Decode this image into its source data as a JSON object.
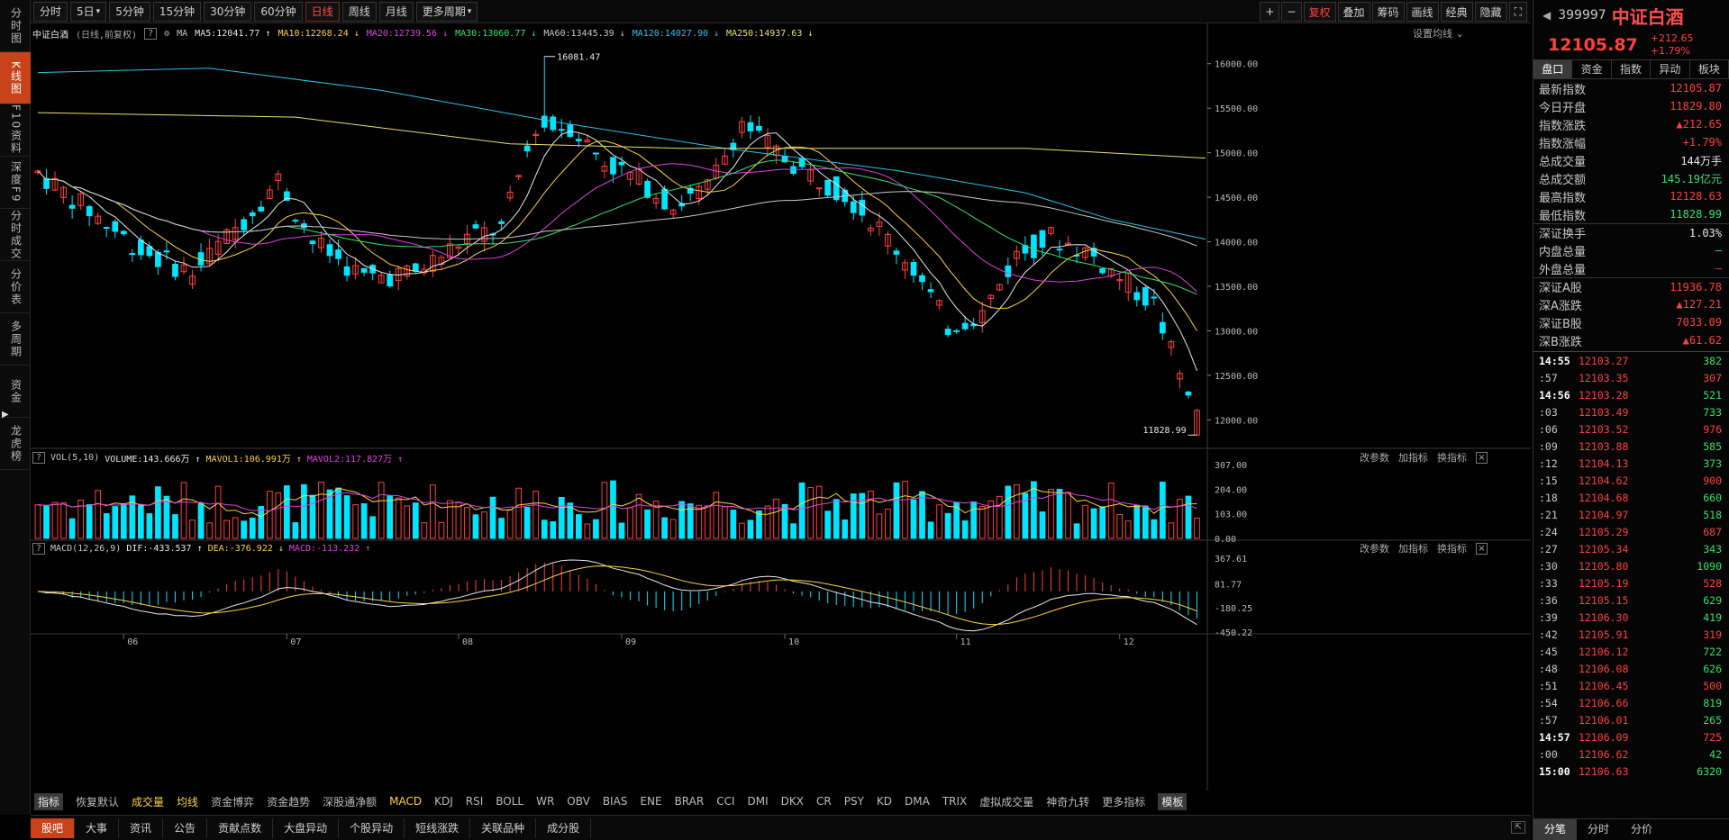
{
  "left_sidebar": {
    "items": [
      "分时图",
      "K线图",
      "F10资料",
      "深度F9",
      "分时成交",
      "分价表",
      "多周期",
      "资金",
      "龙虎榜"
    ],
    "active_index": 1
  },
  "toolbar": {
    "periods": [
      "分时",
      "5日",
      "5分钟",
      "15分钟",
      "30分钟",
      "60分钟",
      "日线",
      "周线",
      "月线",
      "更多周期"
    ],
    "active_period": "日线",
    "right_buttons": [
      "+",
      "−",
      "复权",
      "叠加",
      "筹码",
      "画线",
      "经典",
      "隐藏",
      "⛶"
    ]
  },
  "ma_line": {
    "title": "中证白酒",
    "subtitle": "(日线,前复权)",
    "ma_label": "MA",
    "items": [
      {
        "label": "MA5:12041.77",
        "arrow": "↑",
        "color": "#e8e8e8"
      },
      {
        "label": "MA10:12268.24",
        "arrow": "↓",
        "color": "#ffd23f"
      },
      {
        "label": "MA20:12739.56",
        "arrow": "↓",
        "color": "#e040e0"
      },
      {
        "label": "MA30:13060.77",
        "arrow": "↓",
        "color": "#33e36a"
      },
      {
        "label": "MA60:13445.39",
        "arrow": "↓",
        "color": "#c8c8c8"
      },
      {
        "label": "MA120:14027.90",
        "arrow": "↓",
        "color": "#2ec3e6"
      },
      {
        "label": "MA250:14937.63",
        "arrow": "↓",
        "color": "#e8e070"
      }
    ],
    "settings_label": "设置均线"
  },
  "price_axis": {
    "ticks": [
      16000,
      15500,
      15000,
      14500,
      14000,
      13500,
      13000,
      12500,
      12000
    ]
  },
  "annotations": {
    "high": "16081.47",
    "low": "11828.99"
  },
  "month_labels": [
    "06",
    "07",
    "08",
    "09",
    "10",
    "11",
    "12"
  ],
  "volume_panel": {
    "header": [
      {
        "label": "VOL(5,10)",
        "color": "#c8c8c8"
      },
      {
        "label": "VOLUME:143.666万 ↑",
        "color": "#e8e8e8"
      },
      {
        "label": "MAVOL1:106.991万 ↑",
        "color": "#ffd23f"
      },
      {
        "label": "MAVOL2:117.827万 ↑",
        "color": "#e040e0"
      }
    ],
    "axis": [
      "307.00",
      "204.00",
      "103.00",
      "0.00"
    ],
    "tools": [
      "改参数",
      "加指标",
      "换指标"
    ]
  },
  "macd_panel": {
    "header": [
      {
        "label": "MACD(12,26,9)",
        "color": "#c8c8c8"
      },
      {
        "label": "DIF:-433.537 ↑",
        "color": "#e8e8e8"
      },
      {
        "label": "DEA:-376.922 ↓",
        "color": "#ffd23f"
      },
      {
        "label": "MACD:-113.232 ↑",
        "color": "#e040e0"
      }
    ],
    "axis": [
      "367.61",
      "81.77",
      "-180.25",
      "-450.22"
    ],
    "tools": [
      "改参数",
      "加指标",
      "换指标"
    ]
  },
  "indicator_tabs": [
    "指标",
    "恢复默认",
    "成交量",
    "均线",
    "资金博弈",
    "资金趋势",
    "深股通净额",
    "MACD",
    "KDJ",
    "RSI",
    "BOLL",
    "WR",
    "OBV",
    "BIAS",
    "ENE",
    "BRAR",
    "CCI",
    "DMI",
    "DKX",
    "CR",
    "PSY",
    "KD",
    "DMA",
    "TRIX",
    "虚拟成交量",
    "神奇九转",
    "更多指标",
    "模板"
  ],
  "bottom_tabs": [
    "股吧",
    "大事",
    "资讯",
    "公告",
    "贡献点数",
    "大盘异动",
    "个股异动",
    "短线涨跌",
    "关联品种",
    "成分股"
  ],
  "quote": {
    "code": "399997",
    "name": "中证白酒",
    "price": "12105.87",
    "change": "+212.65",
    "change_pct": "+1.79%",
    "tabs": [
      "盘口",
      "资金",
      "指数",
      "异动",
      "板块"
    ],
    "rows": [
      {
        "k": "最新指数",
        "v": "12105.87",
        "c": "red"
      },
      {
        "k": "今日开盘",
        "v": "11829.80",
        "c": "red"
      },
      {
        "k": "指数涨跌",
        "v": "▲212.65",
        "c": "red"
      },
      {
        "k": "指数涨幅",
        "v": "+1.79%",
        "c": "red"
      },
      {
        "k": "总成交量",
        "v": "144万手",
        "c": "white"
      },
      {
        "k": "总成交额",
        "v": "145.19亿元",
        "c": "green"
      },
      {
        "k": "最高指数",
        "v": "12128.63",
        "c": "red"
      },
      {
        "k": "最低指数",
        "v": "11828.99",
        "c": "green"
      },
      {
        "k": "深证换手",
        "v": "1.03%",
        "c": "white"
      },
      {
        "k": "内盘总量",
        "v": "—",
        "c": "green"
      },
      {
        "k": "外盘总量",
        "v": "—",
        "c": "red"
      },
      {
        "k": "深证A股",
        "v": "11936.78",
        "c": "red"
      },
      {
        "k": "深A涨跌",
        "v": "▲127.21",
        "c": "red"
      },
      {
        "k": "深证B股",
        "v": "7033.09",
        "c": "red"
      },
      {
        "k": "深B涨跌",
        "v": "▲61.62",
        "c": "red"
      }
    ],
    "ticks": [
      {
        "t": "14:55",
        "p": "12103.27",
        "q": "382"
      },
      {
        "t": ":57",
        "p": "12103.35",
        "q": "307"
      },
      {
        "t": "14:56",
        "p": "12103.28",
        "q": "521"
      },
      {
        "t": ":03",
        "p": "12103.49",
        "q": "733"
      },
      {
        "t": ":06",
        "p": "12103.52",
        "q": "976"
      },
      {
        "t": ":09",
        "p": "12103.88",
        "q": "585"
      },
      {
        "t": ":12",
        "p": "12104.13",
        "q": "373"
      },
      {
        "t": ":15",
        "p": "12104.62",
        "q": "900"
      },
      {
        "t": ":18",
        "p": "12104.68",
        "q": "660"
      },
      {
        "t": ":21",
        "p": "12104.97",
        "q": "518"
      },
      {
        "t": ":24",
        "p": "12105.29",
        "q": "687"
      },
      {
        "t": ":27",
        "p": "12105.34",
        "q": "343"
      },
      {
        "t": ":30",
        "p": "12105.80",
        "q": "1090"
      },
      {
        "t": ":33",
        "p": "12105.19",
        "q": "528"
      },
      {
        "t": ":36",
        "p": "12105.15",
        "q": "629"
      },
      {
        "t": ":39",
        "p": "12106.30",
        "q": "419"
      },
      {
        "t": ":42",
        "p": "12105.91",
        "q": "319"
      },
      {
        "t": ":45",
        "p": "12106.12",
        "q": "722"
      },
      {
        "t": ":48",
        "p": "12106.08",
        "q": "626"
      },
      {
        "t": ":51",
        "p": "12106.45",
        "q": "500"
      },
      {
        "t": ":54",
        "p": "12106.66",
        "q": "819"
      },
      {
        "t": ":57",
        "p": "12106.01",
        "q": "265"
      },
      {
        "t": "14:57",
        "p": "12106.09",
        "q": "725"
      },
      {
        "t": ":00",
        "p": "12106.62",
        "q": "42"
      },
      {
        "t": "15:00",
        "p": "12106.63",
        "q": "6320"
      }
    ],
    "bottom_tabs": [
      "分笔",
      "分时",
      "分价"
    ]
  },
  "colors": {
    "up": "#ff4040",
    "down": "#00e5ff",
    "accent": "#c8421a"
  }
}
